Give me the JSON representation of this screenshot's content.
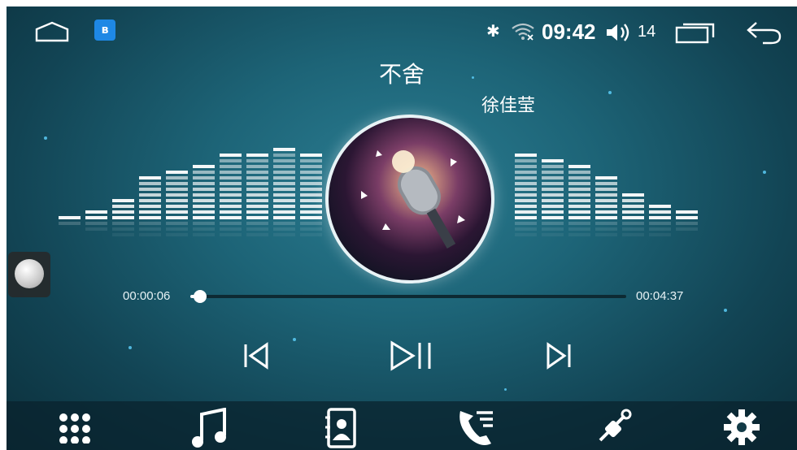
{
  "status_bar": {
    "time": "09:42",
    "volume": "14",
    "icons": [
      "home-icon",
      "bluetooth-app-icon",
      "bluetooth-icon",
      "wifi-icon",
      "volume-icon",
      "recent-apps-icon",
      "back-icon"
    ]
  },
  "player": {
    "title": "不舍",
    "artist": "徐佳莹",
    "elapsed": "00:00:06",
    "duration": "00:04:37",
    "progress": 0.022
  },
  "equalizer_levels": [
    1,
    2,
    4,
    8,
    9,
    10,
    12,
    12,
    13,
    12,
    12,
    11,
    12,
    11,
    10,
    12,
    13,
    12,
    11,
    10,
    8,
    5,
    3,
    2
  ],
  "controls": [
    "previous-icon",
    "play-pause-icon",
    "next-icon"
  ],
  "dock": [
    "apps-grid-icon",
    "music-icon",
    "contacts-icon",
    "call-log-icon",
    "bluetooth-settings-icon",
    "settings-icon"
  ],
  "colors": {
    "accent": "#ffffff",
    "background": "#1d6477"
  }
}
